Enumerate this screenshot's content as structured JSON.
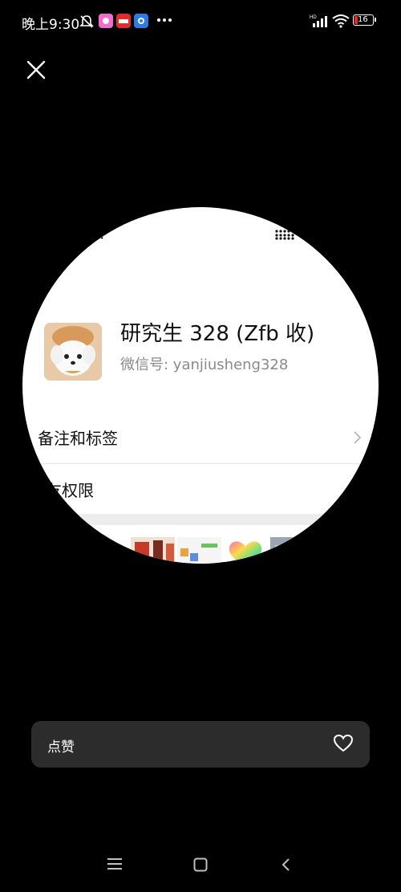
{
  "status_bar": {
    "time": "晚上9:30",
    "battery": "16",
    "icons": [
      "mute-bell-icon",
      "pink-app-icon",
      "red-app-icon",
      "blue-app-icon",
      "more-dots-icon",
      "hd-signal-icon",
      "wifi-icon",
      "battery-icon"
    ]
  },
  "profile": {
    "name": "研究生 328 (Zfb 收)",
    "wechat_id": "微信号: yanjiusheng328"
  },
  "rows": {
    "remark_tags": "备注和标签",
    "friend_permissions": "友权限"
  },
  "like_bar": {
    "label": "点赞"
  },
  "colors": {
    "background": "#000000",
    "like_bar": "#2c2c2c",
    "accent": "#ffffff"
  }
}
